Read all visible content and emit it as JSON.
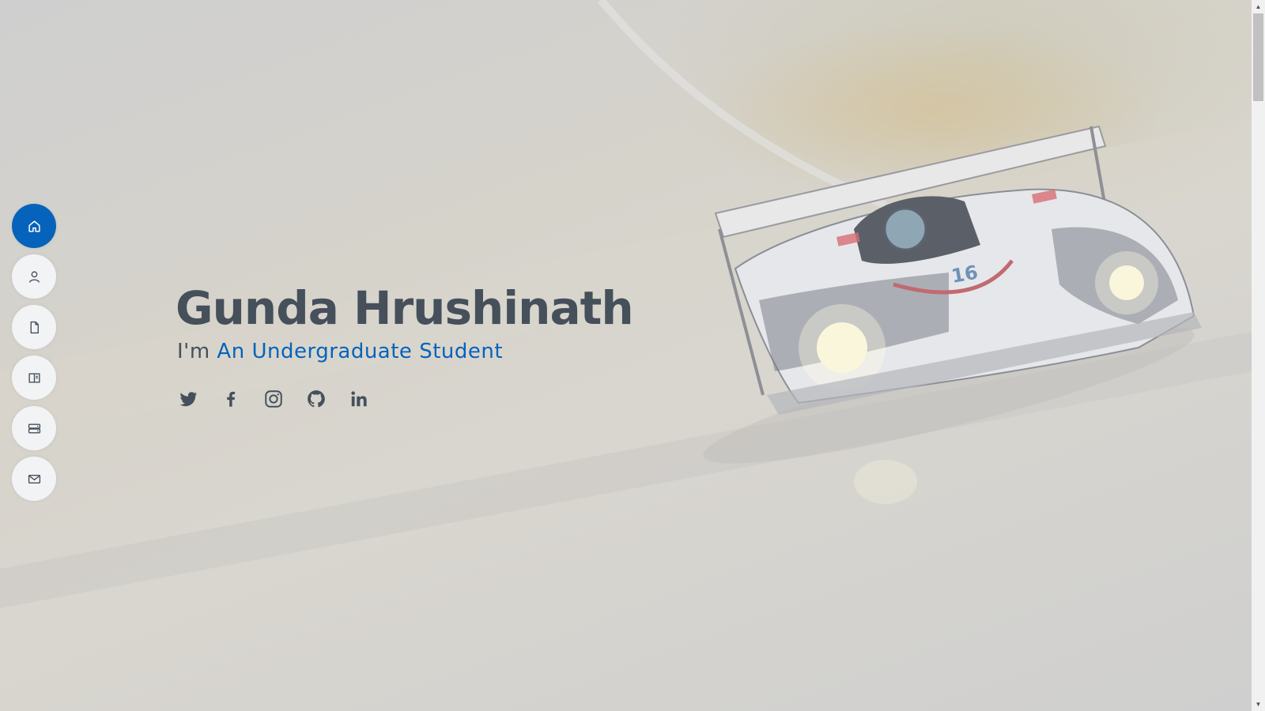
{
  "hero": {
    "name": "Gunda Hrushinath",
    "tagline_prefix": "I'm",
    "tagline_typed": "An Undergraduate Student"
  },
  "nav": {
    "items": [
      {
        "icon": "home-icon",
        "active": true
      },
      {
        "icon": "person-icon",
        "active": false
      },
      {
        "icon": "file-icon",
        "active": false
      },
      {
        "icon": "book-half-icon",
        "active": false
      },
      {
        "icon": "server-icon",
        "active": false
      },
      {
        "icon": "envelope-icon",
        "active": false
      }
    ]
  },
  "social": [
    "twitter-icon",
    "facebook-icon",
    "instagram-icon",
    "github-icon",
    "linkedin-icon"
  ],
  "colors": {
    "accent": "#0563bb",
    "text": "#45505b",
    "nav_bg": "#f2f3f5"
  }
}
